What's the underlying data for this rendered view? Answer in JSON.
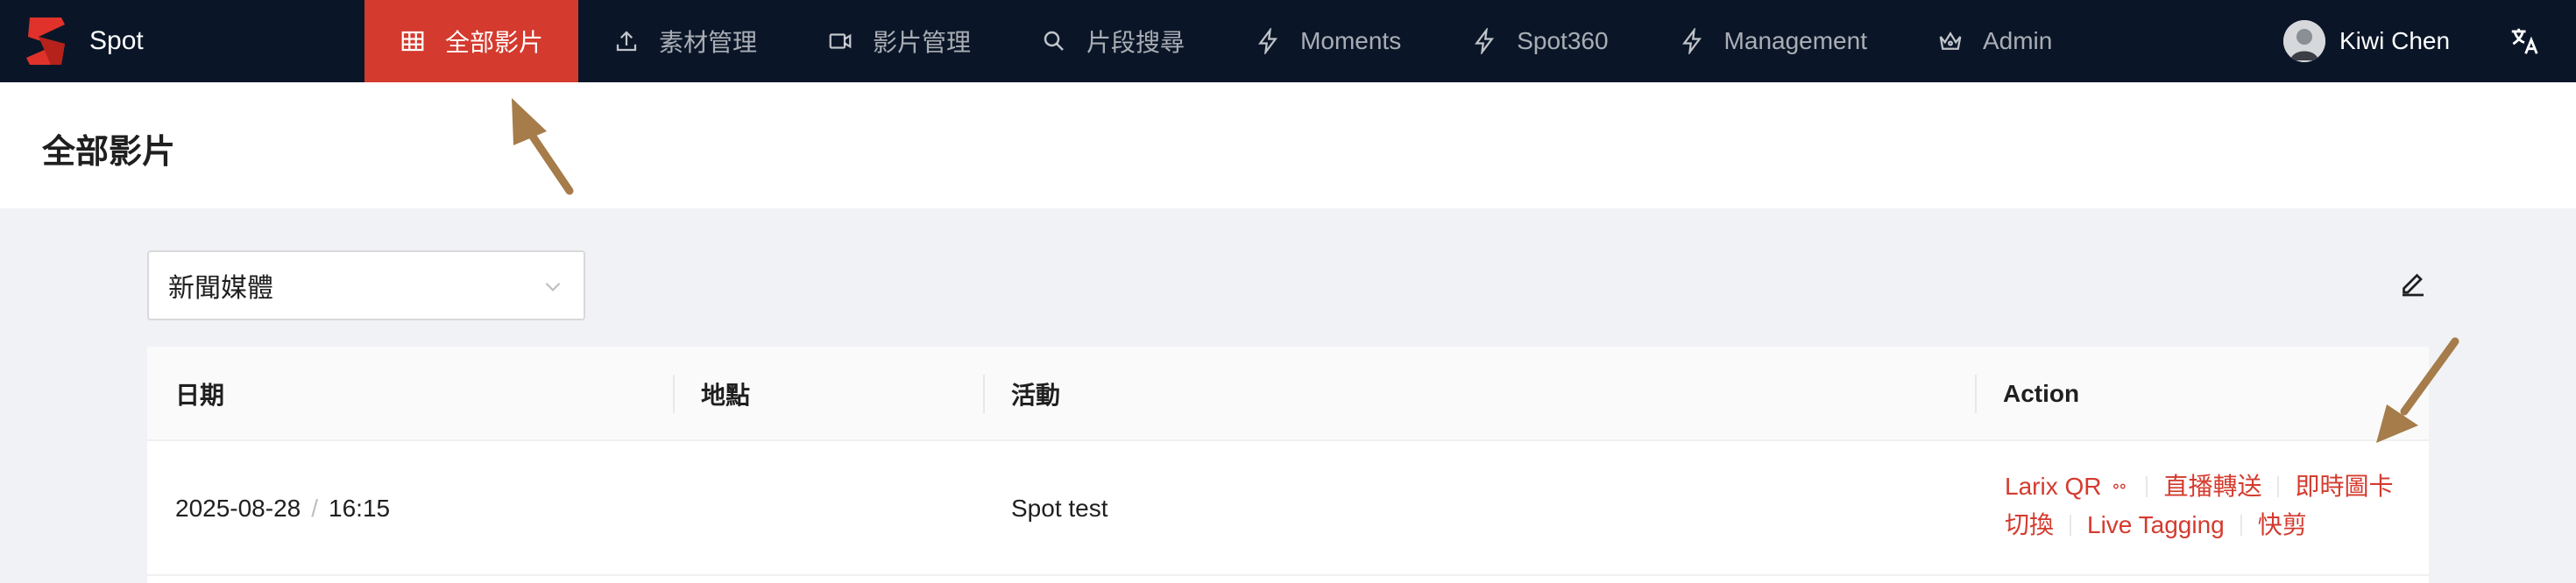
{
  "app": {
    "name": "Spot"
  },
  "nav": {
    "items": [
      {
        "label": "全部影片",
        "icon": "table-icon",
        "active": true
      },
      {
        "label": "素材管理",
        "icon": "upload-icon",
        "active": false
      },
      {
        "label": "影片管理",
        "icon": "video-icon",
        "active": false
      },
      {
        "label": "片段搜尋",
        "icon": "search-icon",
        "active": false
      },
      {
        "label": "Moments",
        "icon": "lightning-icon",
        "active": false
      },
      {
        "label": "Spot360",
        "icon": "lightning-icon",
        "active": false
      },
      {
        "label": "Management",
        "icon": "lightning-icon",
        "active": false
      },
      {
        "label": "Admin",
        "icon": "crown-icon",
        "active": false
      }
    ]
  },
  "user": {
    "name": "Kiwi Chen"
  },
  "page": {
    "title": "全部影片"
  },
  "filter": {
    "selected": "新聞媒體"
  },
  "table": {
    "columns": [
      "日期",
      "地點",
      "活動",
      "Action"
    ],
    "rows": [
      {
        "date": "2025-08-28",
        "time": "16:15",
        "location": "",
        "event": "Spot test",
        "actions": [
          "Larix QR 𐄚",
          "直播轉送",
          "即時圖卡切換",
          "Live Tagging",
          "快剪"
        ]
      }
    ]
  },
  "colors": {
    "nav_bg": "#0a1628",
    "accent": "#d43a2e",
    "page_bg": "#f0f2f5"
  },
  "annotations": {
    "arrows": 2,
    "arrow_color": "#a57c4a"
  }
}
